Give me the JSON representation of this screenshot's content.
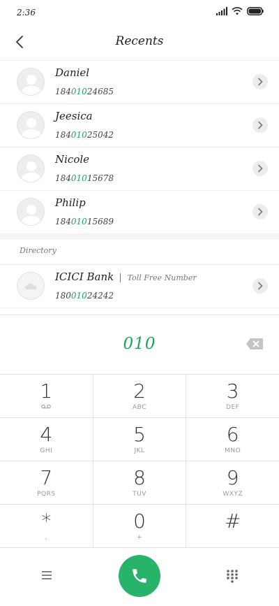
{
  "status_bar": {
    "time": "2:36"
  },
  "header": {
    "title": "Recents"
  },
  "recents": [
    {
      "name": "Daniel",
      "number_pre": "184",
      "number_match": "010",
      "number_post": "24685"
    },
    {
      "name": "Jeesica",
      "number_pre": "184",
      "number_match": "010",
      "number_post": "25042"
    },
    {
      "name": "Nicole",
      "number_pre": "184",
      "number_match": "010",
      "number_post": "15678"
    },
    {
      "name": "Philip",
      "number_pre": "184",
      "number_match": "010",
      "number_post": "15689"
    }
  ],
  "directory": {
    "label": "Directory",
    "items": [
      {
        "name": "ICICI Bank",
        "separator": "|",
        "subtitle": "Toll Free Number",
        "number_pre": "180",
        "number_match": "010",
        "number_post": "24242"
      }
    ]
  },
  "dialer": {
    "input": "010",
    "keys": [
      [
        {
          "digit": "1",
          "letters": ""
        },
        {
          "digit": "2",
          "letters": "ABC"
        },
        {
          "digit": "3",
          "letters": "DEF"
        }
      ],
      [
        {
          "digit": "4",
          "letters": "GHI"
        },
        {
          "digit": "5",
          "letters": "JKL"
        },
        {
          "digit": "6",
          "letters": "MNO"
        }
      ],
      [
        {
          "digit": "7",
          "letters": "PQRS"
        },
        {
          "digit": "8",
          "letters": "TUV"
        },
        {
          "digit": "9",
          "letters": "WXYZ"
        }
      ],
      [
        {
          "digit": "*",
          "letters": ","
        },
        {
          "digit": "0",
          "letters": "+"
        },
        {
          "digit": "#",
          "letters": ""
        }
      ]
    ]
  },
  "colors": {
    "accent": "#1ea35a",
    "call_button": "#27b36a"
  },
  "icons": {
    "back": "chevron-left-icon",
    "chevron": "chevron-right-icon",
    "avatar": "person-icon",
    "voicemail": "voicemail-icon",
    "backspace": "backspace-icon",
    "menu": "menu-icon",
    "call": "phone-icon",
    "keypad": "keypad-icon"
  }
}
